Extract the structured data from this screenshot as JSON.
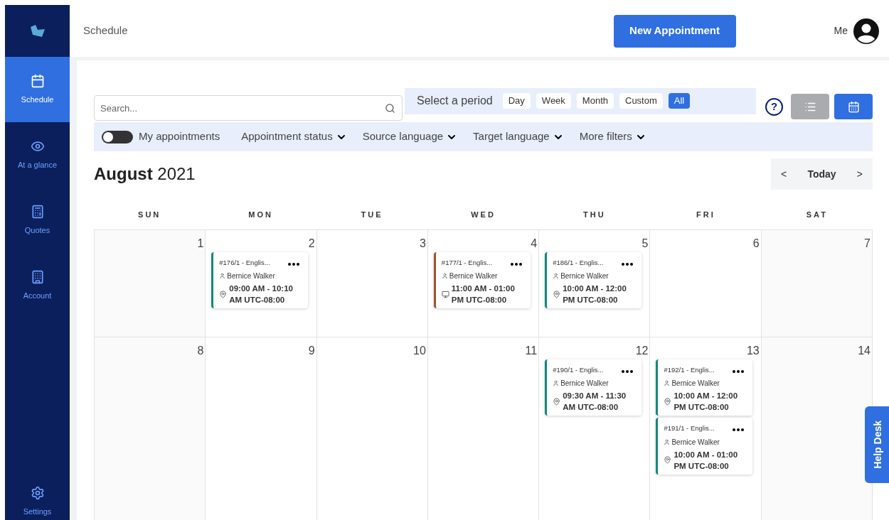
{
  "sidebar": {
    "items": [
      {
        "label": "Schedule",
        "selected": true
      },
      {
        "label": "At a glance",
        "selected": false
      },
      {
        "label": "Quotes",
        "selected": false
      },
      {
        "label": "Account",
        "selected": false
      }
    ],
    "footer": {
      "label": "Settings",
      "selected": false
    }
  },
  "header": {
    "title": "Schedule",
    "new_button": "New Appointment",
    "user": "Me"
  },
  "search": {
    "placeholder": "Search..."
  },
  "period": {
    "label": "Select a period",
    "options": [
      {
        "label": "Day",
        "selected": false
      },
      {
        "label": "Week",
        "selected": false
      },
      {
        "label": "Month",
        "selected": false
      },
      {
        "label": "Custom",
        "selected": false
      },
      {
        "label": "All",
        "selected": true
      }
    ]
  },
  "help_icon": "?",
  "views": [
    {
      "kind": "list",
      "selected": false
    },
    {
      "kind": "calendar",
      "selected": true
    }
  ],
  "filters": {
    "my_appointments": {
      "label": "My appointments",
      "on": false
    },
    "dropdowns": [
      "Appointment status",
      "Source language",
      "Target language",
      "More filters"
    ]
  },
  "calendar": {
    "month": "August",
    "year": "2021",
    "nav": {
      "prev": "<",
      "today": "Today",
      "next": ">"
    },
    "weekdays": [
      "SUN",
      "MON",
      "TUE",
      "WED",
      "THU",
      "FRI",
      "SAT"
    ],
    "weeks": [
      {
        "days": [
          {
            "date": "1"
          },
          {
            "date": "2",
            "events": [
              {
                "title": "#176/1 - Englis...",
                "person": "Bernice Walker",
                "time": "09:00 AM - 10:10 AM UTC-08:00",
                "kind": "location",
                "color": "#12897b"
              }
            ]
          },
          {
            "date": "3"
          },
          {
            "date": "4",
            "events": [
              {
                "title": "#177/1 - Englis...",
                "person": "Bernice Walker",
                "time": "11:00 AM - 01:00 PM UTC-08:00",
                "kind": "video",
                "color": "#a0522d"
              }
            ]
          },
          {
            "date": "5",
            "events": [
              {
                "title": "#186/1 - Englis...",
                "person": "Bernice Walker",
                "time": "10:00 AM - 12:00 PM UTC-08:00",
                "kind": "location",
                "color": "#12897b"
              }
            ]
          },
          {
            "date": "6"
          },
          {
            "date": "7"
          }
        ]
      },
      {
        "days": [
          {
            "date": "8"
          },
          {
            "date": "9"
          },
          {
            "date": "10"
          },
          {
            "date": "11"
          },
          {
            "date": "12",
            "events": [
              {
                "title": "#190/1 - Englis...",
                "person": "Bernice Walker",
                "time": "09:30 AM - 11:30 AM UTC-08:00",
                "kind": "location",
                "color": "#12897b"
              }
            ]
          },
          {
            "date": "13",
            "events": [
              {
                "title": "#192/1 - Englis...",
                "person": "Bernice Walker",
                "time": "10:00 AM - 12:00 PM UTC-08:00",
                "kind": "location",
                "color": "#12897b"
              },
              {
                "title": "#191/1 - Englis...",
                "person": "Bernice Walker",
                "time": "10:00 AM - 01:00 PM UTC-08:00",
                "kind": "location",
                "color": "#12897b"
              }
            ]
          },
          {
            "date": "14"
          }
        ]
      }
    ]
  },
  "help_desk": "Help Desk"
}
